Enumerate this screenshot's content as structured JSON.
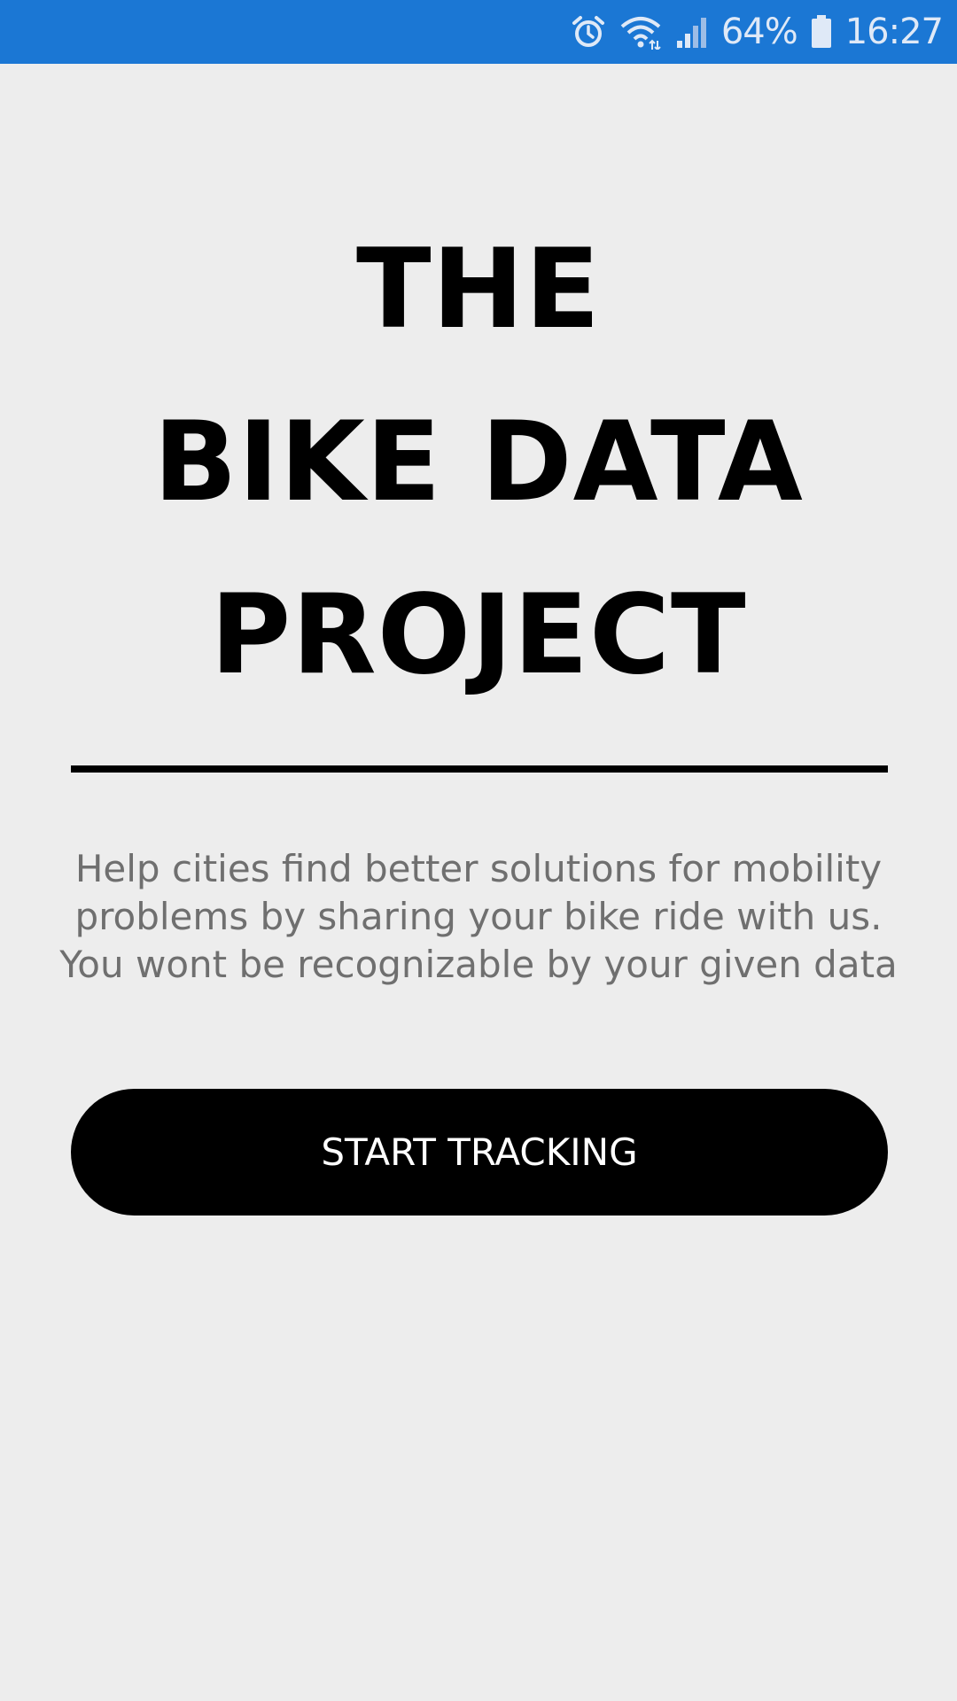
{
  "status_bar": {
    "icons": [
      "alarm-icon",
      "wifi-icon",
      "signal-icon",
      "battery-icon"
    ],
    "battery_percent": "64%",
    "time": "16:27",
    "background_color": "#1b77d4"
  },
  "title": {
    "lines": [
      "THE",
      "BIKE DATA",
      "PROJECT"
    ]
  },
  "description": {
    "lines": [
      "Help cities find better solutions for mobility",
      "problems by sharing your bike ride with us.",
      "You wont be recognizable by your given data"
    ]
  },
  "start_button": {
    "label": "START TRACKING"
  },
  "colors": {
    "background": "#ededed",
    "text_primary": "#000000",
    "text_secondary": "#6f6f6f",
    "button_bg": "#000000",
    "button_text": "#ffffff"
  }
}
